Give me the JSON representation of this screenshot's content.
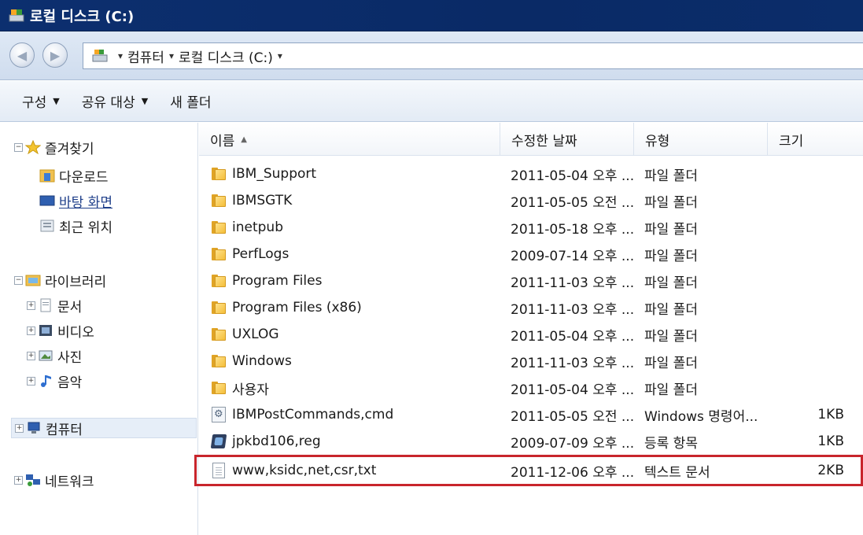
{
  "window": {
    "title": "로컬 디스크 (C:)"
  },
  "address": {
    "crumbs": [
      {
        "label": "컴퓨터"
      },
      {
        "label": "로컬 디스크 (C:)"
      }
    ]
  },
  "toolbar": {
    "organize": "구성",
    "share_with": "공유 대상",
    "new_folder": "새 폴더"
  },
  "sidebar": {
    "favorites": {
      "label": "즐겨찾기",
      "items": [
        {
          "label": "다운로드"
        },
        {
          "label": "바탕 화면"
        },
        {
          "label": "최근 위치"
        }
      ]
    },
    "libraries": {
      "label": "라이브러리",
      "items": [
        {
          "label": "문서"
        },
        {
          "label": "비디오"
        },
        {
          "label": "사진"
        },
        {
          "label": "음악"
        }
      ]
    },
    "computer": {
      "label": "컴퓨터"
    },
    "network": {
      "label": "네트워크"
    }
  },
  "columns": {
    "name": "이름",
    "date": "수정한 날짜",
    "type": "유형",
    "size": "크기"
  },
  "files": [
    {
      "name": "IBM_Support",
      "date": "2011-05-04 오후 ...",
      "type": "파일 폴더",
      "size": "",
      "icon": "folder-icon"
    },
    {
      "name": "IBMSGTK",
      "date": "2011-05-05 오전 ...",
      "type": "파일 폴더",
      "size": "",
      "icon": "folder-icon"
    },
    {
      "name": "inetpub",
      "date": "2011-05-18 오후 ...",
      "type": "파일 폴더",
      "size": "",
      "icon": "folder-icon"
    },
    {
      "name": "PerfLogs",
      "date": "2009-07-14 오후 ...",
      "type": "파일 폴더",
      "size": "",
      "icon": "folder-icon"
    },
    {
      "name": "Program Files",
      "date": "2011-11-03 오후 ...",
      "type": "파일 폴더",
      "size": "",
      "icon": "folder-icon"
    },
    {
      "name": "Program Files (x86)",
      "date": "2011-11-03 오후 ...",
      "type": "파일 폴더",
      "size": "",
      "icon": "folder-icon"
    },
    {
      "name": "UXLOG",
      "date": "2011-05-04 오후 ...",
      "type": "파일 폴더",
      "size": "",
      "icon": "folder-icon"
    },
    {
      "name": "Windows",
      "date": "2011-11-03 오후 ...",
      "type": "파일 폴더",
      "size": "",
      "icon": "folder-icon"
    },
    {
      "name": "사용자",
      "date": "2011-05-04 오후 ...",
      "type": "파일 폴더",
      "size": "",
      "icon": "folder-icon"
    },
    {
      "name": "IBMPostCommands,cmd",
      "date": "2011-05-05 오전 ...",
      "type": "Windows 명령어...",
      "size": "1KB",
      "icon": "cmd-file-icon"
    },
    {
      "name": "jpkbd106,reg",
      "date": "2009-07-09 오후 ...",
      "type": "등록 항목",
      "size": "1KB",
      "icon": "registry-file-icon"
    },
    {
      "name": "www,ksidc,net,csr,txt",
      "date": "2011-12-06 오후 ...",
      "type": "텍스트 문서",
      "size": "2KB",
      "icon": "text-file-icon",
      "highlighted": true
    }
  ],
  "colors": {
    "titlebar": "#0c2f6f",
    "highlight_border": "#c8252c",
    "link": "#1f3f8a"
  }
}
